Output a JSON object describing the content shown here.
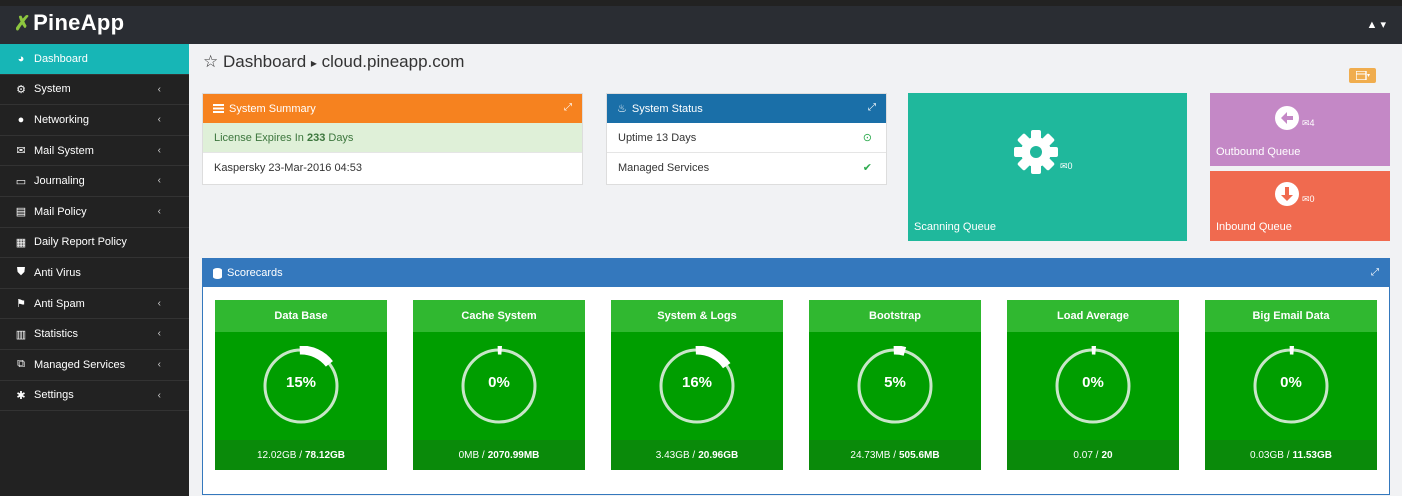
{
  "app": {
    "logo_mark": "✗",
    "logo_text": "PineApp",
    "user_menu": "▲ ▾"
  },
  "sidebar": {
    "items": [
      {
        "label": "Dashboard",
        "icon": "dashboard-icon",
        "chevron": ""
      },
      {
        "label": "System",
        "icon": "cogs-icon",
        "chevron": "‹"
      },
      {
        "label": "Networking",
        "icon": "globe-icon",
        "chevron": "‹"
      },
      {
        "label": "Mail System",
        "icon": "envelope-icon",
        "chevron": "‹"
      },
      {
        "label": "Journaling",
        "icon": "keyboard-icon",
        "chevron": "‹"
      },
      {
        "label": "Mail Policy",
        "icon": "file-icon",
        "chevron": "‹"
      },
      {
        "label": "Daily Report Policy",
        "icon": "calendar-icon",
        "chevron": ""
      },
      {
        "label": "Anti Virus",
        "icon": "shield-icon",
        "chevron": ""
      },
      {
        "label": "Anti Spam",
        "icon": "flag-icon",
        "chevron": "‹"
      },
      {
        "label": "Statistics",
        "icon": "bar-chart-icon",
        "chevron": "‹"
      },
      {
        "label": "Managed Services",
        "icon": "sitemap-icon",
        "chevron": "‹"
      },
      {
        "label": "Settings",
        "icon": "gear-icon",
        "chevron": "‹"
      }
    ]
  },
  "header": {
    "star": "☆",
    "title": "Dashboard",
    "separator": "▸",
    "host": "cloud.pineapp.com"
  },
  "summary": {
    "title": "System Summary",
    "license_prefix": "License Expires In",
    "license_days": "233",
    "license_suffix": "Days",
    "kaspersky": "Kaspersky 23-Mar-2016 04:53"
  },
  "status": {
    "title": "System Status",
    "uptime": "Uptime 13 Days",
    "uptime_icon": "⊙",
    "services": "Managed Services",
    "services_icon": "✔"
  },
  "queues": {
    "scanning": {
      "label": "Scanning Queue",
      "count": "0"
    },
    "outbound": {
      "label": "Outbound Queue",
      "count": "4"
    },
    "inbound": {
      "label": "Inbound Queue",
      "count": "0"
    }
  },
  "scorecards": {
    "title": "Scorecards",
    "cards": [
      {
        "name": "Data Base",
        "percent_label": "15%",
        "percent": 15,
        "used": "12.02GB",
        "total": "78.12GB"
      },
      {
        "name": "Cache System",
        "percent_label": "0%",
        "percent": 0,
        "used": "0MB",
        "total": "2070.99MB"
      },
      {
        "name": "System & Logs",
        "percent_label": "16%",
        "percent": 16,
        "used": "3.43GB",
        "total": "20.96GB"
      },
      {
        "name": "Bootstrap",
        "percent_label": "5%",
        "percent": 5,
        "used": "24.73MB",
        "total": "505.6MB"
      },
      {
        "name": "Load Average",
        "percent_label": "0%",
        "percent": 0,
        "used": "0.07",
        "total": "20"
      },
      {
        "name": "Big Email Data",
        "percent_label": "0%",
        "percent": 0,
        "used": "0.03GB",
        "total": "11.53GB"
      }
    ]
  },
  "colors": {
    "sidebar_active": "#17b6b6",
    "summary_head": "#f6821f",
    "status_head": "#1a6fa8",
    "scanning": "#1fb89c",
    "outbound": "#c488c6",
    "inbound": "#f06a4f",
    "scorecards_head": "#3478bd",
    "card": "#009e00"
  }
}
